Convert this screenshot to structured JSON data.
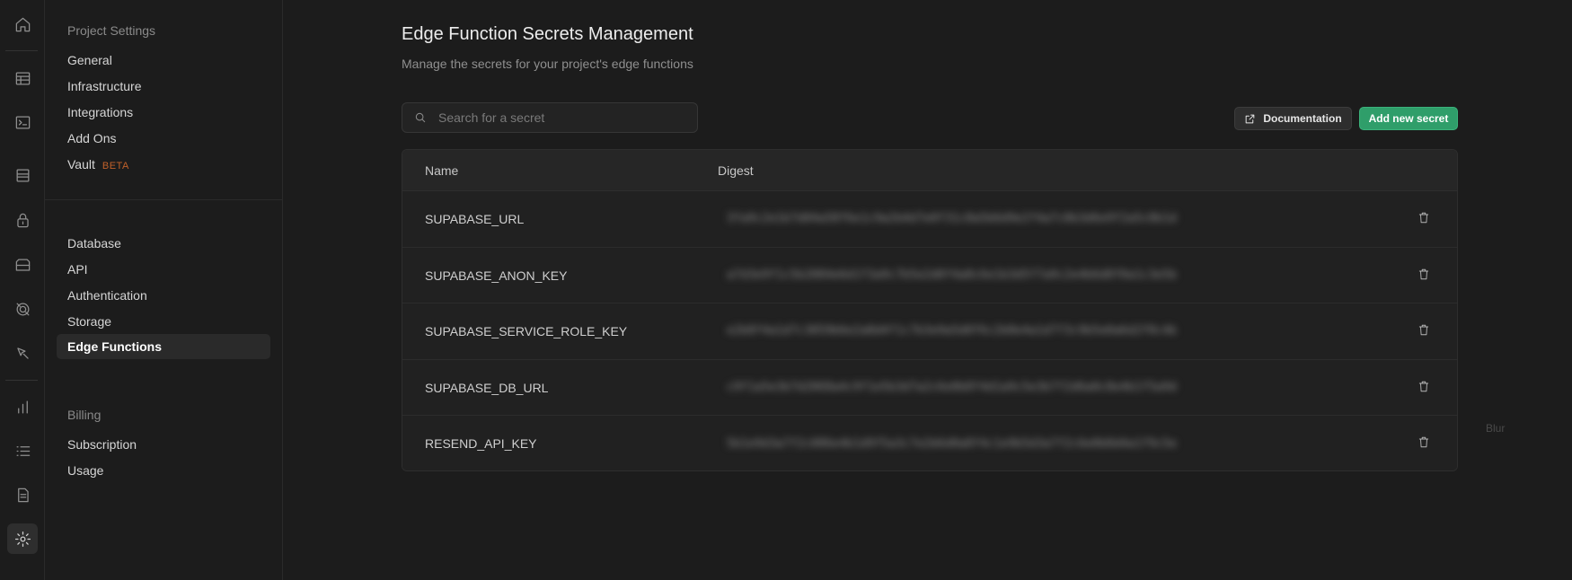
{
  "sidebar": {
    "heading_project": "Project Settings",
    "project_items": [
      "General",
      "Infrastructure",
      "Integrations",
      "Add Ons",
      "Vault"
    ],
    "vault_badge": "BETA",
    "config_items": [
      "Database",
      "API",
      "Authentication",
      "Storage",
      "Edge Functions"
    ],
    "heading_billing": "Billing",
    "billing_items": [
      "Subscription",
      "Usage"
    ]
  },
  "rail_icons": [
    "home-icon",
    "table-editor-icon",
    "sql-editor-icon",
    "database-icon",
    "auth-icon",
    "storage-icon",
    "realtime-icon",
    "edge-functions-icon",
    "reports-icon",
    "logs-icon",
    "api-docs-icon",
    "settings-icon"
  ],
  "main": {
    "title": "Edge Function Secrets Management",
    "subtitle": "Manage the secrets for your project's edge functions",
    "search_placeholder": "Search for a secret",
    "doc_button": "Documentation",
    "add_button": "Add new secret",
    "blur_label": "Blur"
  },
  "table": {
    "headers": [
      "Name",
      "Digest"
    ],
    "rows": [
      {
        "name": "SUPABASE_URL",
        "digest": "3fa9c2e1b7d04a58f6e1c9a2b4d7e0f31c8a5b6d9e2f4a7c0b3d6e9f2a5c8b1d"
      },
      {
        "name": "SUPABASE_ANON_KEY",
        "digest": "a7d3e9f1c5b2084e6d1f3a9c7b5e2d0f4a8c6e1b3d5f7a9c2e4b6d8f0a1c3e5b"
      },
      {
        "name": "SUPABASE_SERVICE_ROLE_KEY",
        "digest": "e2b8f4a1d7c3059b6e2a8d4f1c7b3e9a5d0f6c2b8e4a1d7f3c9b5e0a6d2f8c4b"
      },
      {
        "name": "SUPABASE_DB_URL",
        "digest": "c9f1a5e3b7d2068a4c9f1e5b3d7a2c6e0b8f4d1a9c5e3b7f2d6a0c8e4b1f5a9d"
      },
      {
        "name": "RESEND_API_KEY",
        "digest": "5b1e9d3a7f2c086e4b1d9f5a3c7e2b6d0a8f4c1e9b5d3a7f2c6e0b8d4a1f9c5e"
      }
    ]
  },
  "colors": {
    "background": "#1c1c1c",
    "accent_green": "#2f9e6a",
    "beta_orange": "#c2612a"
  }
}
